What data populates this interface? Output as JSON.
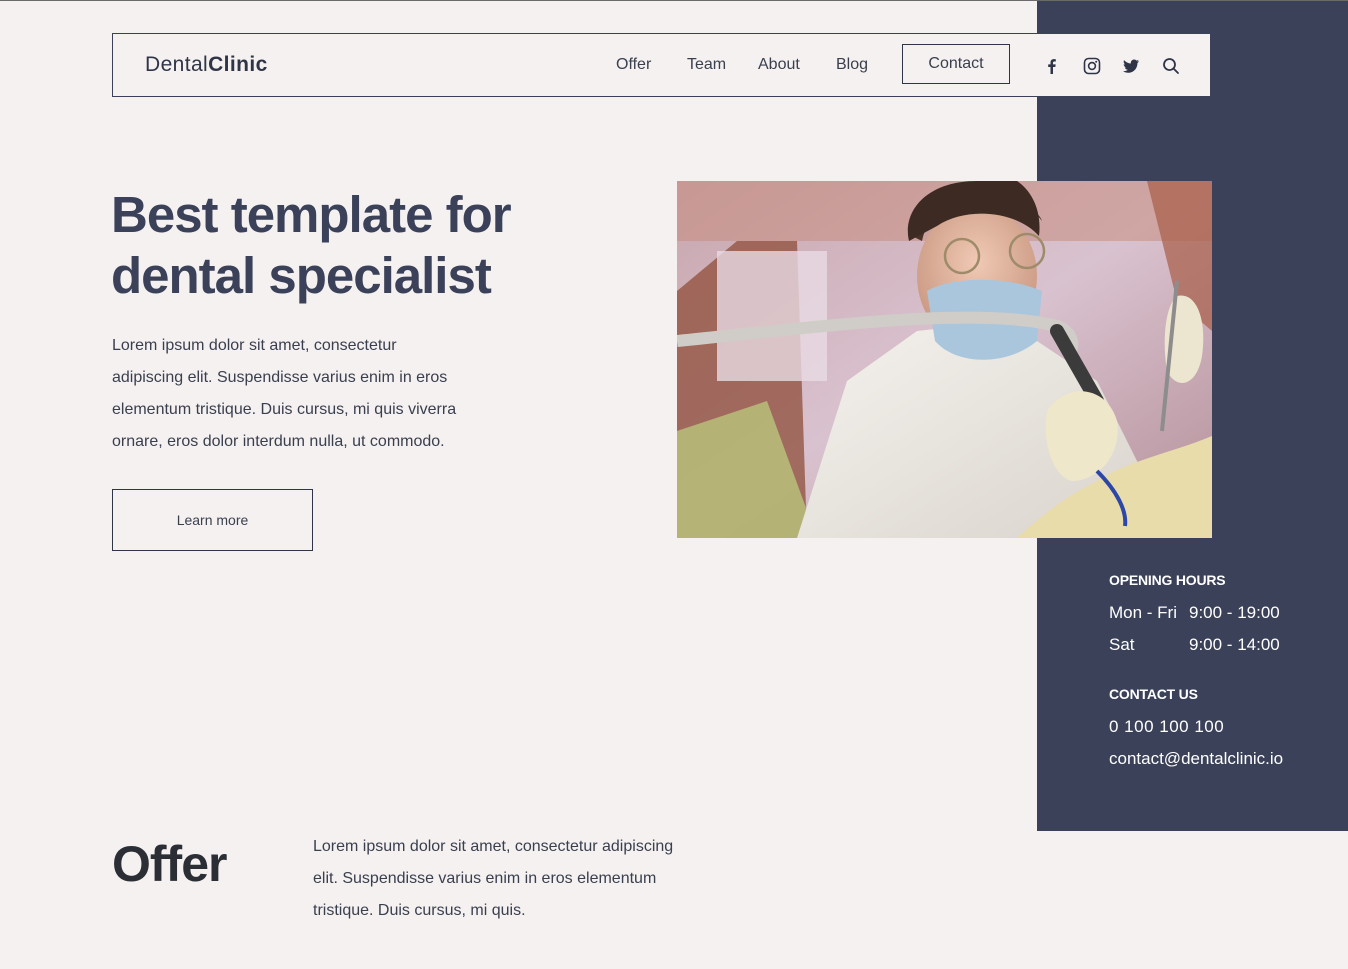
{
  "brand": {
    "name_regular": "Dental",
    "name_bold": "Clinic"
  },
  "nav": {
    "items": [
      "Offer",
      "Team",
      "About",
      "Blog"
    ],
    "contact_label": "Contact",
    "icons": [
      "facebook-icon",
      "instagram-icon",
      "twitter-icon",
      "search-icon"
    ]
  },
  "hero": {
    "title_line1": "Best template for",
    "title_line2": "dental specialist",
    "body": "Lorem ipsum dolor sit amet, consectetur adipiscing elit. Suspendisse varius enim in eros elementum tristique. Duis cursus, mi quis viverra ornare, eros dolor interdum nulla, ut commodo.",
    "button_label": "Learn more"
  },
  "info": {
    "opening_hours_heading": "OPENING HOURS",
    "hours": [
      {
        "days": "Mon - Fri",
        "time": "9:00 - 19:00"
      },
      {
        "days": "Sat",
        "time": "9:00 - 14:00"
      }
    ],
    "contact_heading": "CONTACT US",
    "phone": "0 100 100 100",
    "email": "contact@dentalclinic.io"
  },
  "offer": {
    "title": "Offer",
    "body": "Lorem ipsum dolor sit amet, consectetur adipiscing elit. Suspendisse varius enim in eros elementum tristique. Duis cursus, mi quis."
  },
  "colors": {
    "background": "#f4f1f0",
    "panel": "#3a4158",
    "heading": "#3a4158",
    "text": "#3a3f4e",
    "white": "#ffffff"
  }
}
